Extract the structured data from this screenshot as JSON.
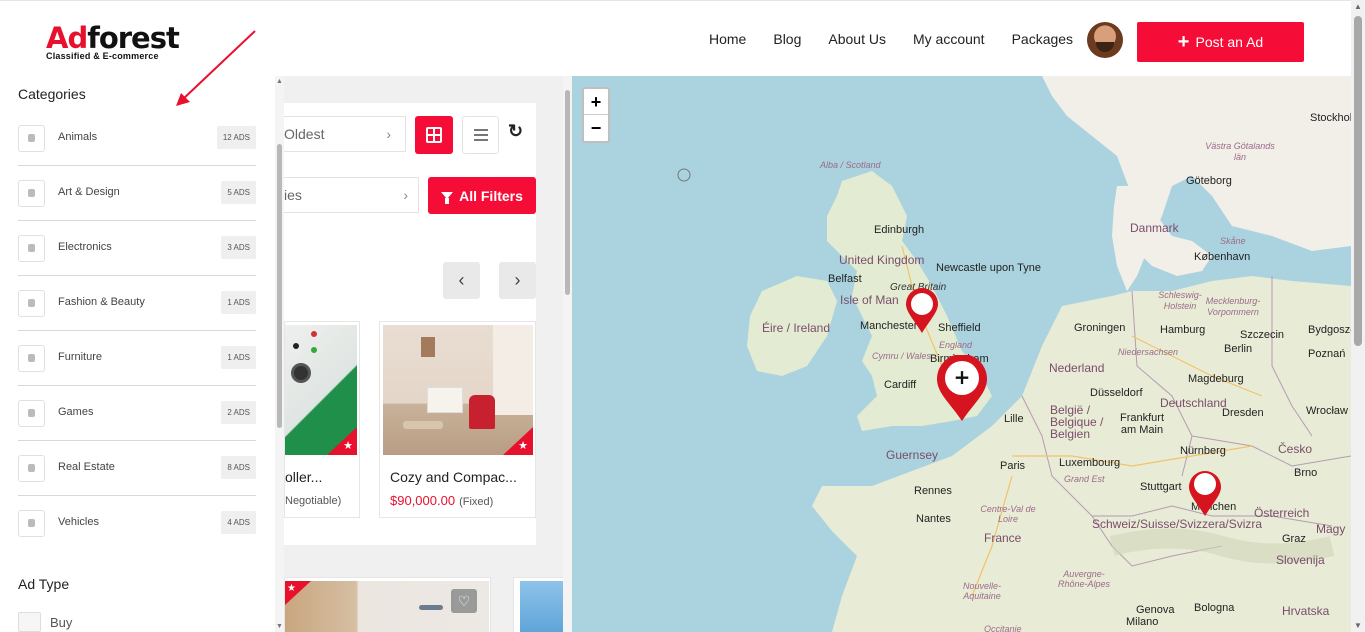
{
  "header": {
    "logo": {
      "brand_a": "Ad",
      "brand_b": "forest",
      "tagline": "Classified & E-commerce"
    },
    "nav": [
      "Home",
      "Blog",
      "About Us",
      "My account",
      "Packages"
    ],
    "post_button": "Post an Ad"
  },
  "toolbar": {
    "sort_text": "Oldest",
    "category_text": "ies",
    "filters_button": "All Filters"
  },
  "cards": [
    {
      "title": "oller...",
      "price": "",
      "price_type": "Negotiable)"
    },
    {
      "title": "Cozy and Compac...",
      "price": "$90,000.00",
      "price_type": "(Fixed)"
    }
  ],
  "drawer": {
    "categories_title": "Categories",
    "categories": [
      {
        "label": "Animals",
        "count": "12 ADS"
      },
      {
        "label": "Art & Design",
        "count": "5 ADS"
      },
      {
        "label": "Electronics",
        "count": "3 ADS"
      },
      {
        "label": "Fashion & Beauty",
        "count": "1 ADS"
      },
      {
        "label": "Furniture",
        "count": "1 ADS"
      },
      {
        "label": "Games",
        "count": "2 ADS"
      },
      {
        "label": "Real Estate",
        "count": "8 ADS"
      },
      {
        "label": "Vehicles",
        "count": "4 ADS"
      }
    ],
    "ad_type_title": "Ad Type",
    "ad_type_options": [
      "Buy"
    ]
  },
  "map": {
    "zoom_in": "+",
    "zoom_out": "−",
    "labels": {
      "alba": "Alba / Scotland",
      "edinburgh": "Edinburgh",
      "uk": "United Kingdom",
      "newcastle": "Newcastle upon Tyne",
      "gb": "Great Britain",
      "belfast": "Belfast",
      "isle_of_man": "Isle of Man",
      "eire": "Éire / Ireland",
      "manchester": "Manchester",
      "sheffield": "Sheffield",
      "england": "England",
      "cymru": "Cymru / Wales",
      "birmingham": "Birmingham",
      "cardiff": "Cardiff",
      "guernsey": "Guernsey",
      "rennes": "Rennes",
      "nantes": "Nantes",
      "paris": "Paris",
      "lille": "Lille",
      "france": "France",
      "centre": "Centre-Val de Loire",
      "nouvelle": "Nouvelle-Aquitaine",
      "auvergne": "Auvergne-Rhône-Alpes",
      "occitanie": "Occitanie",
      "nederland": "Nederland",
      "belgie": "België / Belgique / Belgien",
      "luxembourg": "Luxembourg",
      "grand_est": "Grand Est",
      "strasbourg": "Stuttgart",
      "deutschland": "Deutschland",
      "dusseldorf": "Düsseldorf",
      "frankfurt": "Frankfurt am Main",
      "groningen": "Groningen",
      "hamburg": "Hamburg",
      "niedersachsen": "Niedersachsen",
      "schleswig": "Schleswig-Holstein",
      "mecklenburg": "Mecklenburg-Vorpommern",
      "berlin": "Berlin",
      "magdeburg": "Magdeburg",
      "dresden": "Dresden",
      "nurnberg": "Nürnberg",
      "munchen": "München",
      "szczecin": "Szczecin",
      "bydgoszcz": "Bydgoszcz",
      "poznan": "Poznań",
      "wroclaw": "Wrocław",
      "cesko": "Česko",
      "brno": "Brno",
      "osterreich": "Österreich",
      "schweiz": "Schweiz/Suisse/Svizzera/Svizra",
      "graz": "Graz",
      "slovenija": "Slovenija",
      "hrvatska": "Hrvatska",
      "genova": "Genova",
      "bologna": "Bologna",
      "milano": "Milano",
      "danmark": "Danmark",
      "kobenhavn": "København",
      "goteborg": "Göteborg",
      "vastra": "Västra Götalands län",
      "stockholm": "Stockholm",
      "skane": "Skåne",
      "magy": "Magy"
    }
  }
}
